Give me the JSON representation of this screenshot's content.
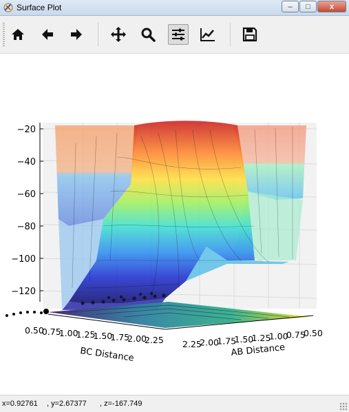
{
  "window": {
    "title": "Surface Plot",
    "minimize": "–",
    "maximize": "□",
    "close": "x"
  },
  "toolbar": {
    "buttons": [
      {
        "name": "home-button",
        "icon": "home-icon"
      },
      {
        "name": "back-button",
        "icon": "arrow-left-icon"
      },
      {
        "name": "forward-button",
        "icon": "arrow-right-icon"
      },
      {
        "name": "pan-button",
        "icon": "move-icon"
      },
      {
        "name": "zoom-button",
        "icon": "magnifier-icon"
      },
      {
        "name": "subplots-button",
        "icon": "sliders-icon"
      },
      {
        "name": "edit-axes-button",
        "icon": "line-chart-icon"
      },
      {
        "name": "save-button",
        "icon": "floppy-disk-icon"
      }
    ]
  },
  "chart_data": {
    "type": "surface",
    "xlabel": "AB Distance",
    "ylabel": "BC Distance",
    "x_ticks": [
      "2.25",
      "2.00",
      "1.75",
      "1.50",
      "1.25",
      "1.00",
      "0.75",
      "0.50"
    ],
    "y_ticks": [
      "0.50",
      "0.75",
      "1.00",
      "1.25",
      "1.50",
      "1.75",
      "2.00",
      "2.25"
    ],
    "z_ticks": [
      "−20",
      "−40",
      "−60",
      "−80",
      "−100",
      "−120"
    ],
    "z_values": [
      -20,
      -40,
      -60,
      -80,
      -100,
      -120
    ],
    "colormap": "jet",
    "grid": true
  },
  "status": {
    "x": "x=0.92761",
    "y": ", y=2.67377",
    "z": ", z=-167.749"
  }
}
